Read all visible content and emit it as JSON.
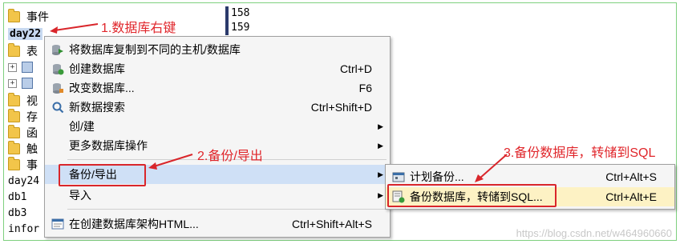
{
  "tree": {
    "items": [
      {
        "type": "folder",
        "label": "事件"
      },
      {
        "type": "db-selected",
        "label": "day22"
      },
      {
        "type": "folder",
        "label": "表"
      },
      {
        "type": "table",
        "label": ""
      },
      {
        "type": "table",
        "label": ""
      },
      {
        "type": "folder",
        "label": "视"
      },
      {
        "type": "folder",
        "label": "存"
      },
      {
        "type": "folder",
        "label": "函"
      },
      {
        "type": "folder",
        "label": "触"
      },
      {
        "type": "folder",
        "label": "事"
      },
      {
        "type": "db",
        "label": "day24"
      },
      {
        "type": "db",
        "label": "db1"
      },
      {
        "type": "db",
        "label": "db3"
      },
      {
        "type": "db",
        "label": "infor"
      }
    ]
  },
  "line_numbers": [
    "158",
    "159"
  ],
  "context_menu": {
    "items": [
      {
        "label": "将数据库复制到不同的主机/数据库",
        "shortcut": "",
        "icon": "copy-db-icon"
      },
      {
        "label": "创建数据库",
        "shortcut": "Ctrl+D",
        "icon": "create-db-icon"
      },
      {
        "label": "改变数据库...",
        "shortcut": "F6",
        "icon": "alter-db-icon"
      },
      {
        "label": "新数据搜索",
        "shortcut": "Ctrl+Shift+D",
        "icon": "search-icon"
      },
      {
        "label": "创/建",
        "shortcut": "",
        "submenu": true
      },
      {
        "label": "更多数据库操作",
        "shortcut": "",
        "submenu": true
      },
      {
        "label": "备份/导出",
        "shortcut": "",
        "submenu": true
      },
      {
        "label": "导入",
        "shortcut": "",
        "submenu": true
      },
      {
        "label": "在创建数据库架构HTML...",
        "shortcut": "Ctrl+Shift+Alt+S",
        "icon": "schema-html-icon"
      }
    ]
  },
  "submenu": {
    "items": [
      {
        "label": "计划备份...",
        "shortcut": "Ctrl+Alt+S",
        "icon": "schedule-backup-icon"
      },
      {
        "label": "备份数据库，转储到SQL...",
        "shortcut": "Ctrl+Alt+E",
        "icon": "backup-db-icon"
      }
    ]
  },
  "annotations": {
    "step1": "1.数据库右键",
    "step2": "2.备份/导出",
    "step3": "3.备份数据库，转储到SQL"
  },
  "watermark": "https://blog.csdn.net/w464960660",
  "colors": {
    "annotation_red": "#d9262b",
    "menu_highlight": "#cfe0f6",
    "submenu_highlight": "#fdf2c4"
  }
}
